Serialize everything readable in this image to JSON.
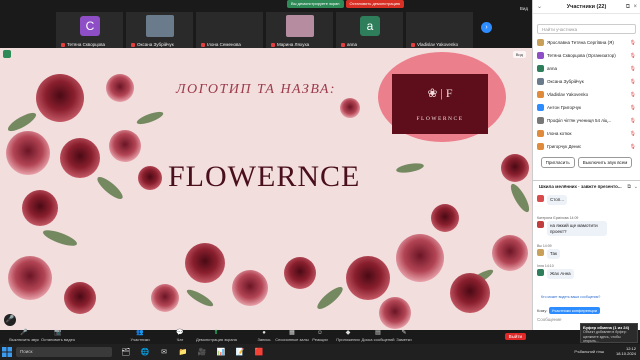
{
  "meeting": {
    "sharing_status": "Вы демонстрируете экран",
    "stop_share": "Остановить демонстрацию",
    "view_label": "Вид"
  },
  "participants_tiles": [
    {
      "name": "Тетяна Скворцова",
      "initial": "C",
      "color": "#8e4ec6",
      "kind": "avatar"
    },
    {
      "name": "Оксана Зубрійчук",
      "initial": "",
      "color": "#6a7b8c",
      "kind": "photo"
    },
    {
      "name": "Ілона Семенова",
      "initial": "",
      "color": "#2a2a2a",
      "kind": "blank"
    },
    {
      "name": "Марина Ляхуха",
      "initial": "",
      "color": "#b58ca0",
      "kind": "photo"
    },
    {
      "name": "anna",
      "initial": "a",
      "color": "#2e7d5b",
      "kind": "avatar"
    },
    {
      "name": "Vladislav Yakovenko",
      "initial": "",
      "color": "#2a2a2a",
      "kind": "blank"
    }
  ],
  "slide": {
    "heading": "ЛОГОТИП ТА НАЗВА:",
    "brand": "FLOWERNCE",
    "logo_mark": "❀ | F",
    "logo_text": "FLOWERNCE",
    "view_chip": "Вид"
  },
  "panel": {
    "title": "Участники (22)",
    "search_placeholder": "Найти участника",
    "participants": [
      {
        "name": "Ярославна Тетяна Сергіївна (Я)",
        "color": "#c9a05a"
      },
      {
        "name": "Тетяна Скворцова (Организатор)",
        "color": "#8e4ec6"
      },
      {
        "name": "anna",
        "color": "#2e7d5b"
      },
      {
        "name": "Оксана Зубрійчук",
        "color": "#6a7b8c"
      },
      {
        "name": "Vladislav Yakovenko",
        "color": "#e08a3c"
      },
      {
        "name": "Антон Григорчук",
        "color": "#2d8cff"
      },
      {
        "name": "Профіл чіп'ян учениця 54 ліц...",
        "color": "#777777"
      },
      {
        "name": "Ілона котюк",
        "color": "#e08a3c"
      },
      {
        "name": "Григорчук Денис",
        "color": "#e08a3c"
      }
    ],
    "invite_button": "Пригласить",
    "mute_all_button": "Выключить звук всем",
    "chat_title": "Шкила мелённих · завжте презенто...",
    "chat_notice": "Кто может видеть ваши сообщения?",
    "chat_to_label": "Кому:",
    "chat_to_value": "Участники конференции",
    "chat_input": "Сообщение"
  },
  "chat_messages": [
    {
      "meta": "",
      "text": "Стоп...",
      "color": "#d94a4a"
    },
    {
      "meta": "Катерина Єрмілова 14:09",
      "text": "на яжкий ще мамотити проект?",
      "color": "#c13c3c"
    },
    {
      "meta": "Вы 14:09",
      "text": "Так",
      "color": "#c9a05a"
    },
    {
      "meta": "Ілля 14:10",
      "text": "Жах Анна",
      "color": "#2e7d5b"
    }
  ],
  "controls": [
    {
      "label": "Выключить звук",
      "icon": "🎤"
    },
    {
      "label": "Остановить видео",
      "icon": "📷"
    },
    {
      "label": "Участники",
      "icon": "👥"
    },
    {
      "label": "Чат",
      "icon": "💬"
    },
    {
      "label": "Демонстрация экрана",
      "icon": "⬆",
      "green": true
    },
    {
      "label": "Запись",
      "icon": "●"
    },
    {
      "label": "Сессионные залы",
      "icon": "▦"
    },
    {
      "label": "Реакции",
      "icon": "☺"
    },
    {
      "label": "Приложения",
      "icon": "◆"
    },
    {
      "label": "Доска сообщений",
      "icon": "▤"
    },
    {
      "label": "Заметки",
      "icon": "✎"
    }
  ],
  "end_button": "Выйти",
  "taskbar": {
    "search_placeholder": "Поиск",
    "apps": [
      "🗂",
      "🌐",
      "✉",
      "📁",
      "🎥",
      "📊",
      "📝",
      "🟥"
    ],
    "tray_text": "Ръбальний гінш",
    "time": "12:12",
    "date": "18.10.2024"
  },
  "notification": {
    "title": "Буфер обмена (1 из 24)",
    "body": "Объект добавлен в буфер: щелкните здесь, чтобы открыть..."
  }
}
